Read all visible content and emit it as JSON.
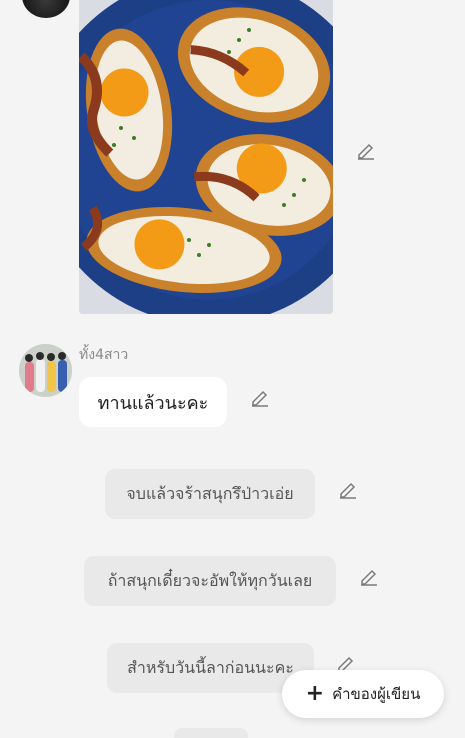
{
  "thread": {
    "top_image_description": "food photo",
    "sender_name": "ทั้ง4สาว",
    "messages": [
      {
        "text": "ทานแล้วนะคะ"
      },
      {
        "text": "จบแล้วจร้าสนุกรึป่าวเอ่ย"
      },
      {
        "text": "ถ้าสนุกเดี๋ยวจะอัพให้ทุกวันเลย"
      },
      {
        "text": "สำหรับวันนี้ลาก่อนนะคะ"
      }
    ]
  },
  "fab": {
    "icon": "plus-icon",
    "label": "คำของผู้เขียน"
  },
  "colors": {
    "background": "#f4f4f5",
    "bubble_grey": "#e9e9ea",
    "bubble_white": "#ffffff",
    "plate": "#1d3f86"
  }
}
